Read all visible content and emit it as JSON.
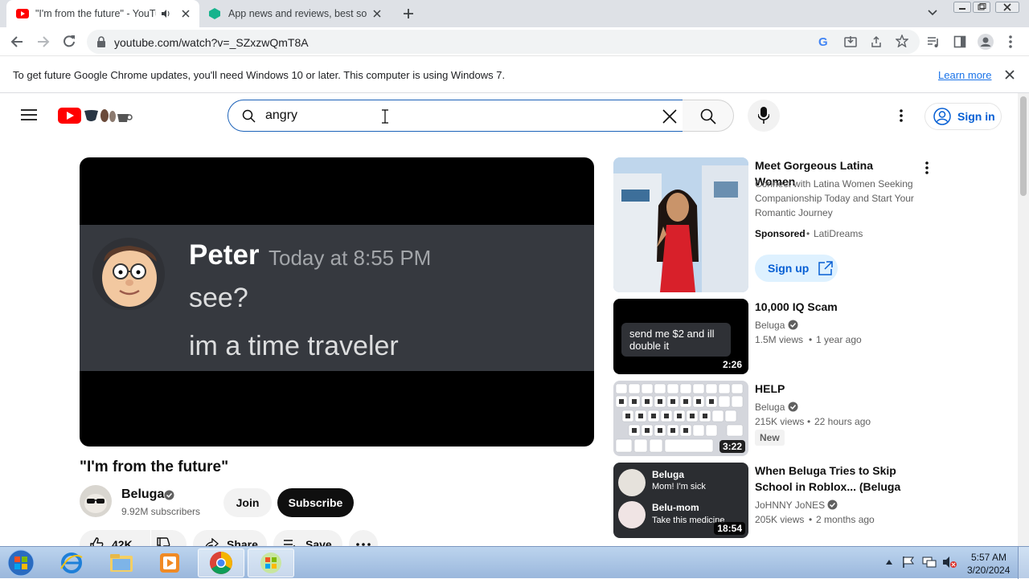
{
  "browser": {
    "tabs": [
      {
        "title": "\"I'm from the future\" - YouTu",
        "active": true
      },
      {
        "title": "App news and reviews, best softw",
        "active": false
      }
    ],
    "url": "youtube.com/watch?v=_SZxzwQmT8A",
    "infobar": {
      "message": "To get future Google Chrome updates, you'll need Windows 10 or later. This computer is using Windows 7.",
      "link": "Learn more"
    }
  },
  "youtube": {
    "search": {
      "value": "angry",
      "placeholder": "Search"
    },
    "signin_label": "Sign in",
    "player": {
      "username": "Peter",
      "timestamp": "Today at 8:55 PM",
      "line1": "see?",
      "line2": "im a time traveler"
    },
    "video": {
      "title": "\"I'm from the future\"",
      "channel": "Beluga",
      "subscribers": "9.92M subscribers",
      "join_label": "Join",
      "subscribe_label": "Subscribe",
      "likes": "42K",
      "share_label": "Share",
      "save_label": "Save"
    },
    "ad": {
      "title": "Meet Gorgeous Latina Women",
      "description": "Connect with Latina Women Seeking Companionship Today and Start Your Romantic Journey",
      "sponsored": "Sponsored",
      "advertiser": "LatiDreams",
      "cta": "Sign up"
    },
    "recommendations": [
      {
        "title": "10,000 IQ Scam",
        "channel": "Beluga",
        "views": "1.5M views",
        "age": "1 year ago",
        "duration": "2:26",
        "badge": "",
        "thumb_text": "send me $2 and ill double it"
      },
      {
        "title": "HELP",
        "channel": "Beluga",
        "views": "215K views",
        "age": "22 hours ago",
        "duration": "3:22",
        "badge": "New",
        "thumb_text": ""
      },
      {
        "title": "When Beluga Tries to Skip School in Roblox... (Beluga vs...",
        "channel": "JoHNNY JoNES",
        "views": "205K views",
        "age": "2 months ago",
        "duration": "18:54",
        "badge": "",
        "thumb_text": ""
      }
    ],
    "thumb3": {
      "name1": "Beluga",
      "msg1": "Mom! I'm sick",
      "name2": "Belu-mom",
      "msg2": "Take this medicine"
    }
  },
  "taskbar": {
    "time": "5:57 AM",
    "date": "3/20/2024"
  },
  "colors": {
    "youtube_red": "#ff0000",
    "link_blue": "#065fd4",
    "discord_bg": "#36393f"
  }
}
